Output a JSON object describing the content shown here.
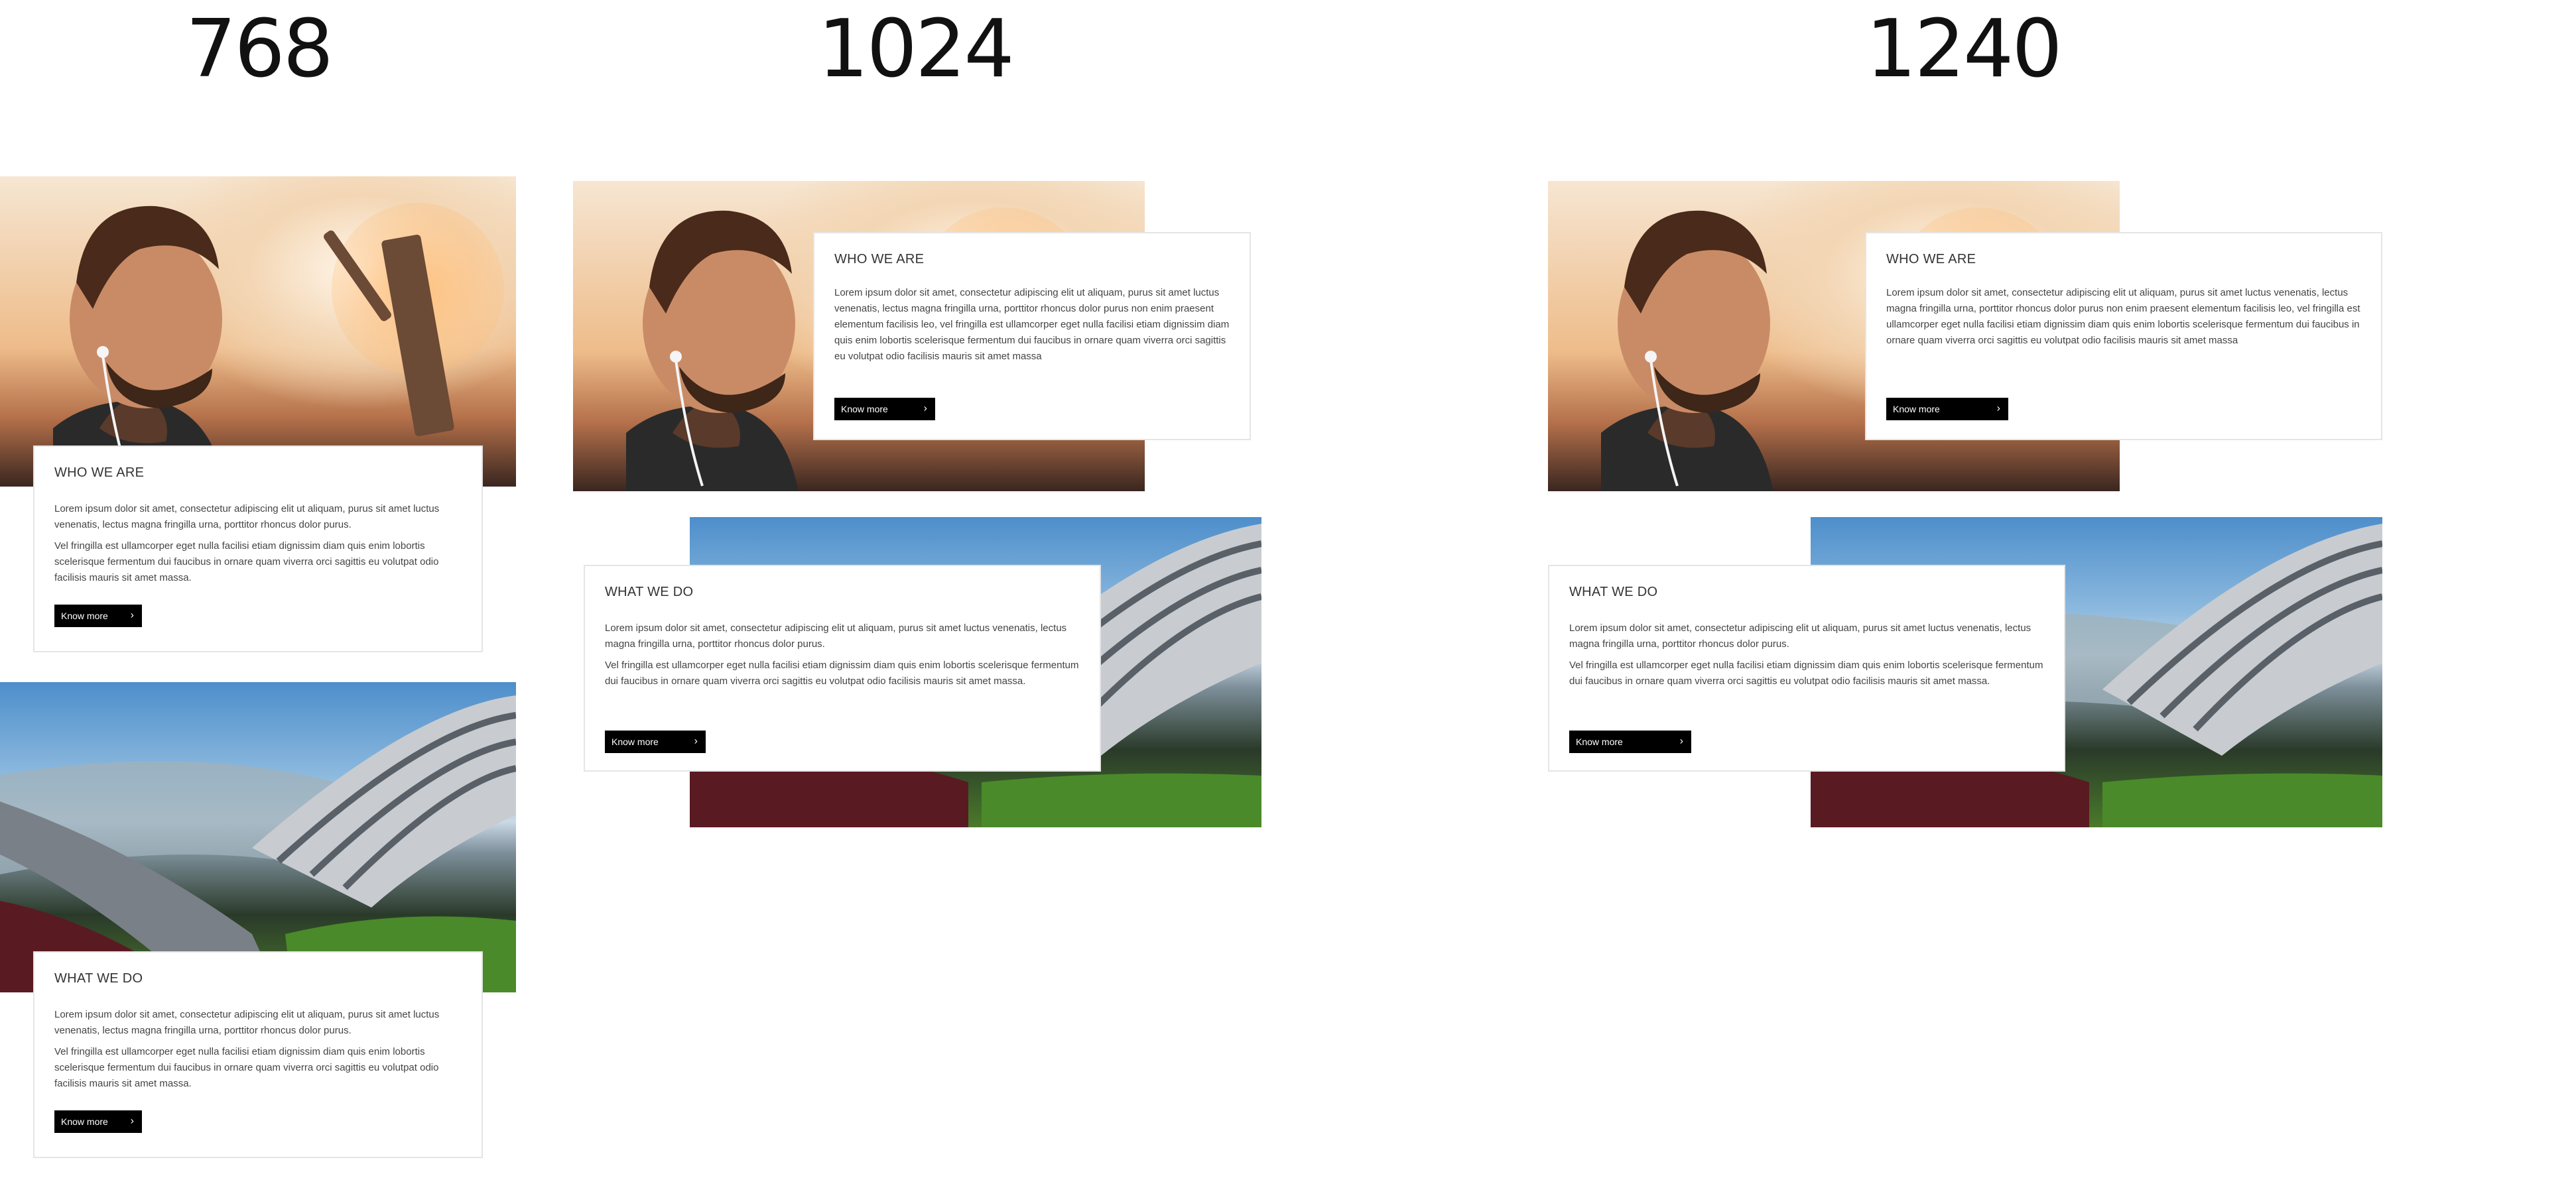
{
  "breakpoints": [
    "768",
    "1024",
    "1240"
  ],
  "sections": {
    "who": {
      "heading": "WHO WE ARE",
      "para_short_1": "Lorem ipsum dolor sit amet, consectetur adipiscing elit ut aliquam, purus sit amet luctus venenatis, lectus magna fringilla urna, porttitor rhoncus dolor purus.",
      "para_short_2": "Vel fringilla est ullamcorper eget nulla facilisi etiam dignissim diam quis enim lobortis scelerisque fermentum dui faucibus in ornare quam viverra orci sagittis eu volutpat odio facilisis mauris sit amet massa.",
      "para_long": "Lorem ipsum dolor sit amet, consectetur adipiscing elit ut aliquam, purus sit amet luctus venenatis, lectus magna fringilla urna, porttitor rhoncus dolor purus non enim praesent elementum facilisis leo, vel fringilla est ullamcorper eget nulla facilisi etiam dignissim diam quis enim lobortis scelerisque fermentum dui faucibus in ornare quam viverra orci sagittis eu volutpat odio facilisis mauris sit amet massa",
      "button": "Know more"
    },
    "what": {
      "heading": "WHAT WE DO",
      "para_1": "Lorem ipsum dolor sit amet, consectetur adipiscing elit ut aliquam, purus sit amet luctus venenatis, lectus magna fringilla urna, porttitor rhoncus dolor purus.",
      "para_2": "Vel fringilla est ullamcorper eget nulla facilisi etiam dignissim diam quis enim lobortis scelerisque fermentum dui faucibus in ornare quam viverra orci sagittis eu volutpat odio facilisis mauris sit amet massa.",
      "button": "Know more"
    }
  },
  "icons": {
    "button_arrow": "chevron-right-icon"
  },
  "colors": {
    "button_bg": "#000000",
    "button_text": "#ffffff",
    "card_border": "#e5e5e5"
  }
}
